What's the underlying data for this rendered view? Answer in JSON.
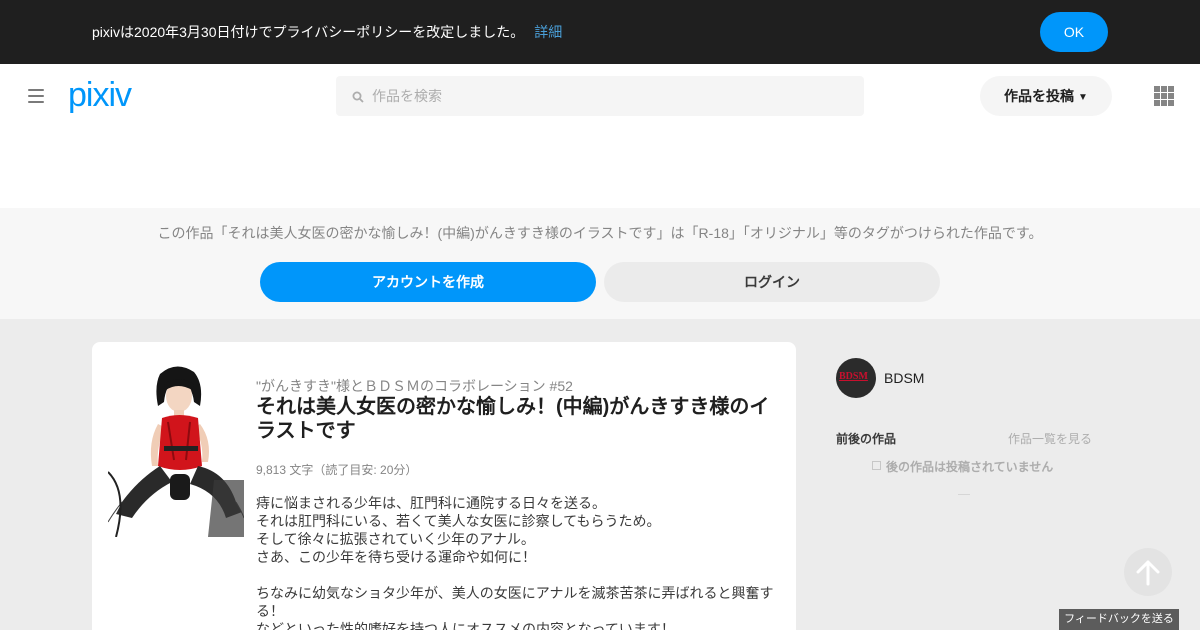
{
  "notice": {
    "message": "pixivは2020年3月30日付けでプライバシーポリシーを改定しました。",
    "link": "詳細",
    "ok": "OK"
  },
  "header": {
    "logo": "pixiv",
    "search_placeholder": "作品を検索",
    "post_label": "作品を投稿"
  },
  "band": {
    "message": "この作品「それは美人女医の密かな愉しみ！(中編)がんきすき様のイラストです」は「R-18」「オリジナル」等のタグがつけられた作品です。",
    "create_account": "アカウントを作成",
    "login": "ログイン"
  },
  "novel": {
    "series": "\"がんきすき\"様とＢＤＳＭのコラボレーション #52",
    "title": "それは美人女医の密かな愉しみ！(中編)がんきすき様のイラストです",
    "meta": "9,813 文字（読了目安: 20分）",
    "description": "痔に悩まされる少年は、肛門科に通院する日々を送る。\nそれは肛門科にいる、若くて美人な女医に診察してもらうため。\nそして徐々に拡張されていく少年のアナル。\nさあ、この少年を待ち受ける運命や如何に！\n\nちなみに幼気なショタ少年が、美人の女医にアナルを滅茶苦茶に弄ばれると興奮する！\nなどといった性的嗜好を持つ人にオススメの内容となっています！"
  },
  "sidebar": {
    "avatar_text": "BDSM",
    "author": "BDSM",
    "nav_heading": "前後の作品",
    "nav_list": "作品一覧を見る",
    "next_none": "後の作品は投稿されていません"
  },
  "feedback": "フィードバックを送る",
  "colors": {
    "accent": "#0096fa",
    "notice_bg": "#1f1f1f"
  }
}
